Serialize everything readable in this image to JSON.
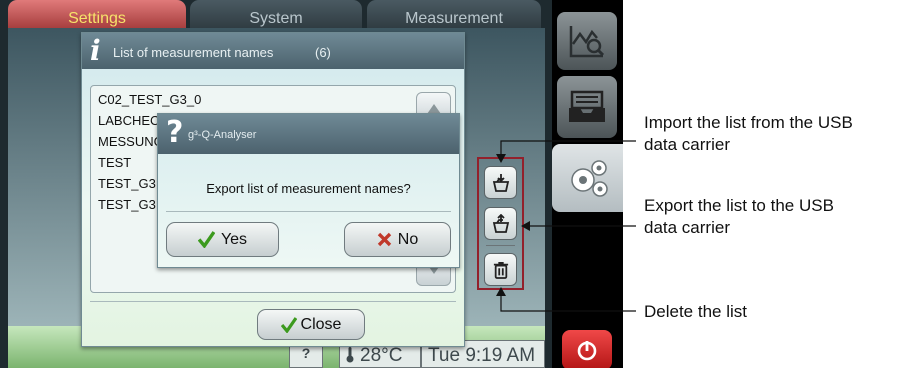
{
  "tabs": [
    "Settings",
    "System",
    "Measurement"
  ],
  "list_dialog": {
    "title": "List of measurement names",
    "count": "(6)",
    "items": [
      "C02_TEST_G3_0",
      "LABCHEC",
      "MESSUNG",
      "TEST",
      "TEST_G3",
      "TEST_G3"
    ],
    "close_label": "Close"
  },
  "confirm_dialog": {
    "title": "g³-Q-Analyser",
    "message": "Export list of measurement names?",
    "yes_label": "Yes",
    "no_label": "No"
  },
  "status_bar": {
    "help": "?",
    "temperature": "28°C",
    "time": "Tue 9:19 AM"
  },
  "callouts": {
    "import": [
      "Import the list from the USB",
      "data carrier"
    ],
    "export": [
      "Export the list to the USB",
      "data carrier"
    ],
    "delete": "Delete the list"
  },
  "colors": {
    "highlight_frame": "#93202b",
    "active_tab": "#a33a3a",
    "active_tab_text": "#f6e36a",
    "status_bar": "#9fd090",
    "power_button": "#d22222",
    "check_green": "#3c9a1e",
    "cross_red": "#c0392b"
  },
  "icons": [
    "info-icon",
    "question-icon",
    "trash-icon",
    "usb-import-icon",
    "usb-export-icon",
    "check-icon",
    "cross-icon",
    "chart-icon",
    "archive-icon",
    "gears-icon",
    "power-icon",
    "thermometer-icon"
  ]
}
